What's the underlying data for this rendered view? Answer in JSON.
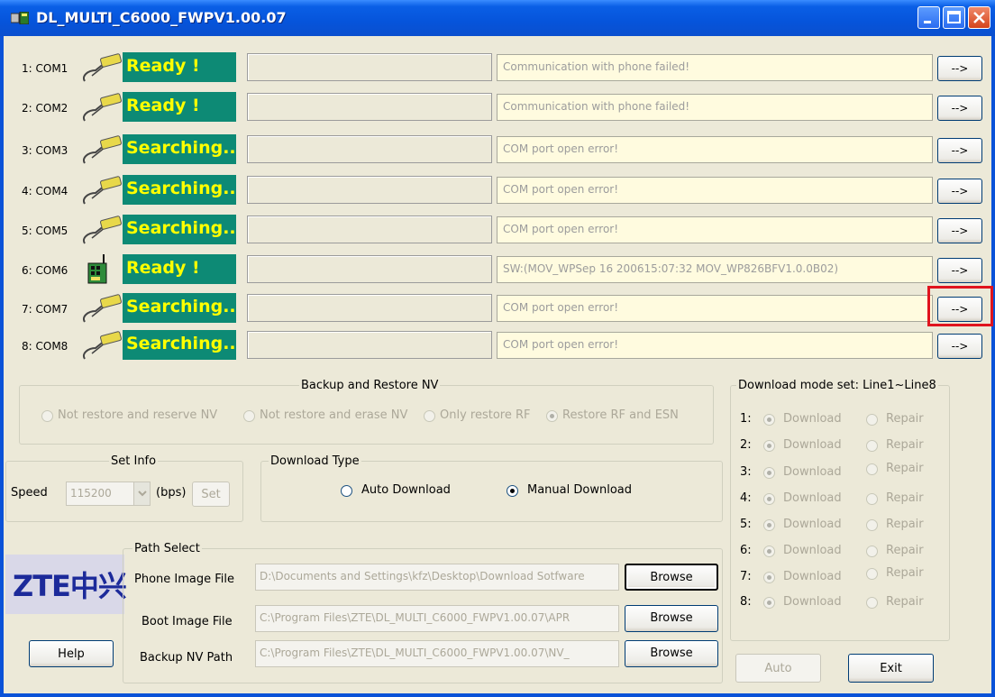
{
  "window": {
    "title": "DL_MULTI_C6000_FWPV1.00.07"
  },
  "ports": [
    {
      "label": "1: COM1",
      "status": "Ready !",
      "message": "Communication with phone failed!",
      "button": "-->",
      "icon": "cable-icon"
    },
    {
      "label": "2: COM2",
      "status": "Ready !",
      "message": "Communication with phone failed!",
      "button": "-->",
      "icon": "cable-icon"
    },
    {
      "label": "3: COM3",
      "status": "Searching...",
      "message": "COM port open error!",
      "button": "-->",
      "icon": "cable-icon"
    },
    {
      "label": "4: COM4",
      "status": "Searching...",
      "message": "COM port open error!",
      "button": "-->",
      "icon": "cable-icon"
    },
    {
      "label": "5: COM5",
      "status": "Searching...",
      "message": "COM port open error!",
      "button": "-->",
      "icon": "cable-icon"
    },
    {
      "label": "6: COM6",
      "status": "Ready !",
      "message": "SW:(MOV_WPSep 16 200615:07:32 MOV_WP826BFV1.0.0B02)",
      "button": "-->",
      "icon": "phone-board-icon"
    },
    {
      "label": "7: COM7",
      "status": "Searching...",
      "message": "COM port open error!",
      "button": "-->",
      "icon": "cable-icon"
    },
    {
      "label": "8: COM8",
      "status": "Searching...",
      "message": "COM port open error!",
      "button": "-->",
      "icon": "cable-icon"
    }
  ],
  "backup": {
    "title": "Backup and Restore NV",
    "options": [
      "Not restore and reserve NV",
      "Not restore and erase NV",
      "Only restore RF",
      "Restore RF and ESN"
    ],
    "selected": "Restore RF and ESN"
  },
  "set_info": {
    "title": "Set Info",
    "speed_label": "Speed",
    "speed_value": "115200",
    "unit": "(bps)",
    "set_button": "Set"
  },
  "download_type": {
    "title": "Download Type",
    "auto": "Auto Download",
    "manual": "Manual Download",
    "selected": "Manual Download"
  },
  "download_mode": {
    "title": "Download mode set: Line1~Line8",
    "lines": [
      {
        "num": "1:",
        "download": "Download",
        "repair": "Repair"
      },
      {
        "num": "2:",
        "download": "Download",
        "repair": "Repair"
      },
      {
        "num": "3:",
        "download": "Download",
        "repair": "Repair"
      },
      {
        "num": "4:",
        "download": "Download",
        "repair": "Repair"
      },
      {
        "num": "5:",
        "download": "Download",
        "repair": "Repair"
      },
      {
        "num": "6:",
        "download": "Download",
        "repair": "Repair"
      },
      {
        "num": "7:",
        "download": "Download",
        "repair": "Repair"
      },
      {
        "num": "8:",
        "download": "Download",
        "repair": "Repair"
      }
    ],
    "auto_button": "Auto",
    "exit_button": "Exit"
  },
  "path_select": {
    "title": "Path Select",
    "phone_label": "Phone Image File",
    "phone_value": "D:\\Documents and Settings\\kfz\\Desktop\\Download Sotfware",
    "boot_label": "Boot Image File",
    "boot_value": "C:\\Program Files\\ZTE\\DL_MULTI_C6000_FWPV1.00.07\\APR",
    "nv_label": "Backup NV Path",
    "nv_value": "C:\\Program Files\\ZTE\\DL_MULTI_C6000_FWPV1.00.07\\NV_",
    "browse": "Browse"
  },
  "logo_text": "ZTE中兴",
  "help_button": "Help",
  "colors": {
    "status_bg": "#0d8a75",
    "status_text": "#ffff00",
    "message_bg": "#fffbdf",
    "highlight": "#e0141e"
  }
}
